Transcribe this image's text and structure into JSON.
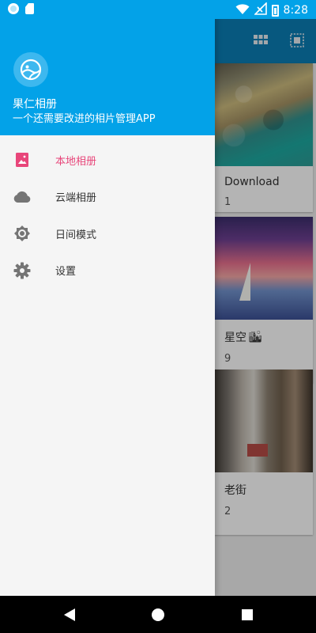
{
  "status_bar": {
    "time": "8:28",
    "icons": [
      "notification-ring-icon",
      "sd-card-icon",
      "wifi-icon",
      "no-signal-icon",
      "battery-icon"
    ]
  },
  "toolbar": {
    "icons": [
      "grid-view-icon",
      "select-all-icon"
    ]
  },
  "drawer": {
    "app_name": "果仁相册",
    "slogan": "一个还需要改进的相片管理APP",
    "menu": [
      {
        "label": "本地相册",
        "icon": "local-album-icon",
        "active": true
      },
      {
        "label": "云端相册",
        "icon": "cloud-icon",
        "active": false
      },
      {
        "label": "日间模式",
        "icon": "brightness-icon",
        "active": false
      },
      {
        "label": "设置",
        "icon": "settings-gear-icon",
        "active": false
      }
    ]
  },
  "albums": [
    {
      "name": "Download",
      "count": "1"
    },
    {
      "name": "星空",
      "emoji": "🏙",
      "count": "9"
    },
    {
      "name": "老街",
      "count": "2"
    }
  ],
  "colors": {
    "primary": "#03a2e8",
    "toolbar_dim": "#0a7ab0",
    "accent": "#e8467a",
    "drawer_bg": "#f5f5f5",
    "icon_gray": "#757575"
  },
  "nav_bar": {
    "icons": [
      "back-triangle-icon",
      "home-circle-icon",
      "recents-square-icon"
    ]
  }
}
